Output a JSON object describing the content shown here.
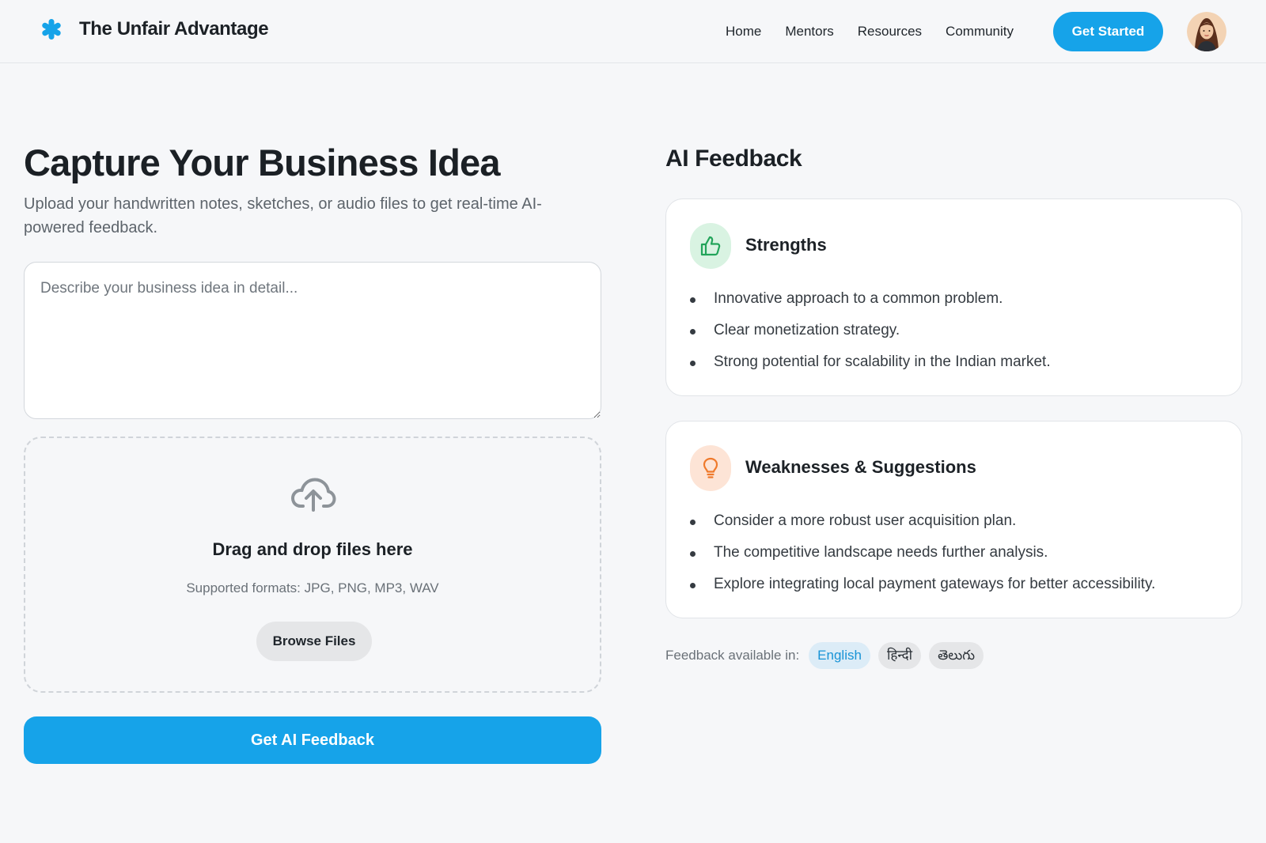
{
  "header": {
    "brand_name": "The Unfair Advantage",
    "nav": [
      "Home",
      "Mentors",
      "Resources",
      "Community"
    ],
    "cta_label": "Get Started"
  },
  "capture": {
    "title": "Capture Your Business Idea",
    "subtitle": "Upload your handwritten notes, sketches, or audio files to get real-time AI-powered feedback.",
    "idea_placeholder": "Describe your business idea in detail...",
    "idea_value": "",
    "drop_title": "Drag and drop files here",
    "drop_formats": "Supported formats: JPG, PNG, MP3, WAV",
    "browse_label": "Browse Files",
    "submit_label": "Get AI Feedback"
  },
  "feedback": {
    "title": "AI Feedback",
    "strengths": {
      "title": "Strengths",
      "icon": "thumbs-up-icon",
      "items": [
        "Innovative approach to a common problem.",
        "Clear monetization strategy.",
        "Strong potential for scalability in the Indian market."
      ]
    },
    "weaknesses": {
      "title": "Weaknesses & Suggestions",
      "icon": "lightbulb-icon",
      "items": [
        "Consider a more robust user acquisition plan.",
        "The competitive landscape needs further analysis.",
        "Explore integrating local payment gateways for better accessibility."
      ]
    },
    "languages_label": "Feedback available in:",
    "languages": [
      "English",
      "हिन्दी",
      "తెలుగు"
    ],
    "selected_language": "English"
  },
  "colors": {
    "accent": "#16a3e9",
    "strength_icon_bg": "#d9f3e2",
    "strength_icon": "#22a45a",
    "weakness_icon_bg": "#fde4d6",
    "weakness_icon": "#ef7a2c"
  }
}
